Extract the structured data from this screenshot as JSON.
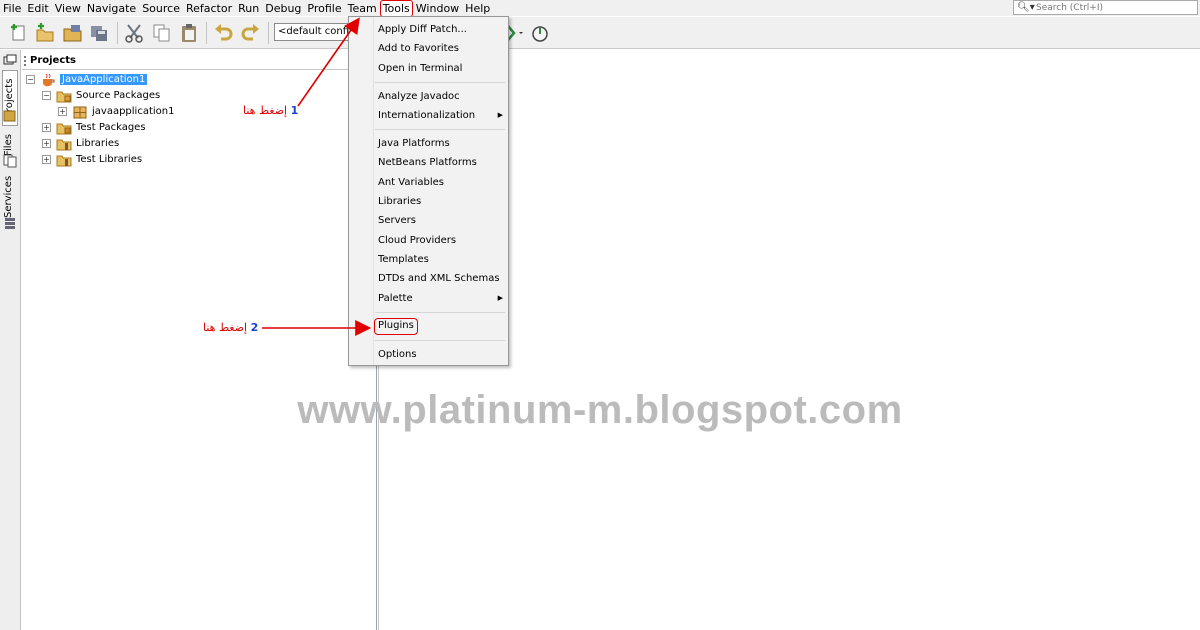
{
  "menubar": {
    "items": [
      "File",
      "Edit",
      "View",
      "Navigate",
      "Source",
      "Refactor",
      "Run",
      "Debug",
      "Profile",
      "Team",
      "Tools",
      "Window",
      "Help"
    ],
    "active": "Tools"
  },
  "search": {
    "placeholder": "Search (Ctrl+I)",
    "icon": "search-icon"
  },
  "toolbar": {
    "config_value": "<default config>"
  },
  "side_tabs": [
    "Projects",
    "Files",
    "Services"
  ],
  "projects_panel": {
    "title": "Projects",
    "tree": [
      {
        "label": "JavaApplication1",
        "expander": "−",
        "selected": true,
        "icon": "coffee-cup-icon"
      },
      {
        "label": "Source Packages",
        "expander": "−",
        "icon": "source-packages-folder-icon"
      },
      {
        "label": "javaapplication1",
        "expander": "+",
        "icon": "package-icon"
      },
      {
        "label": "Test Packages",
        "expander": "+",
        "icon": "test-packages-folder-icon"
      },
      {
        "label": "Libraries",
        "expander": "+",
        "icon": "libraries-folder-icon"
      },
      {
        "label": "Test Libraries",
        "expander": "+",
        "icon": "test-libraries-folder-icon"
      }
    ]
  },
  "tools_menu": {
    "groups": [
      [
        "Apply Diff Patch...",
        "Add to Favorites",
        "Open in Terminal"
      ],
      [
        "Analyze Javadoc",
        "Internationalization"
      ],
      [
        "Java Platforms",
        "NetBeans Platforms",
        "Ant Variables",
        "Libraries",
        "Servers",
        "Cloud Providers",
        "Templates",
        "DTDs and XML Schemas",
        "Palette"
      ],
      [
        "Plugins"
      ],
      [
        "Options"
      ]
    ],
    "submenu_items": [
      "Internationalization",
      "Palette"
    ],
    "highlighted": "Plugins"
  },
  "annotations": [
    {
      "number": "1",
      "text": "إضغط هنا"
    },
    {
      "number": "2",
      "text": "إضغط هنا"
    }
  ],
  "watermark": "www.platinum-m.blogspot.com",
  "colors": {
    "annotation_red": "#e00000",
    "annotation_blue": "#1a3fd1",
    "selection": "#3399ff"
  }
}
